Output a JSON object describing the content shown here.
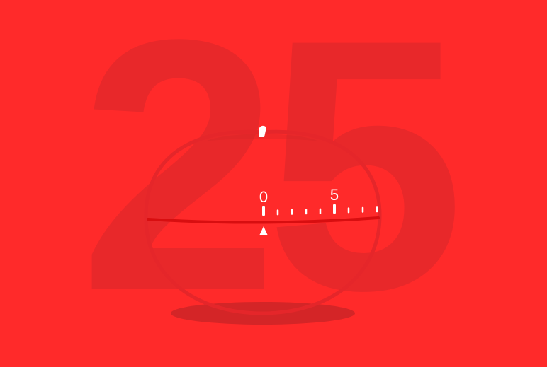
{
  "background": {
    "color": "#ff2a2a",
    "digits": "25",
    "digits_color": "#e8282a"
  },
  "timer": {
    "body_color": "#ff2a2a",
    "outline_color": "#e5262a",
    "shadow_color": "#d42527",
    "stem_color": "#ffffff",
    "dial_line_color": "#d80e10",
    "tick_color": "#ffffff",
    "pointer_color": "#ffffff",
    "marks": [
      {
        "label": "0"
      },
      {
        "label": "5"
      }
    ]
  }
}
